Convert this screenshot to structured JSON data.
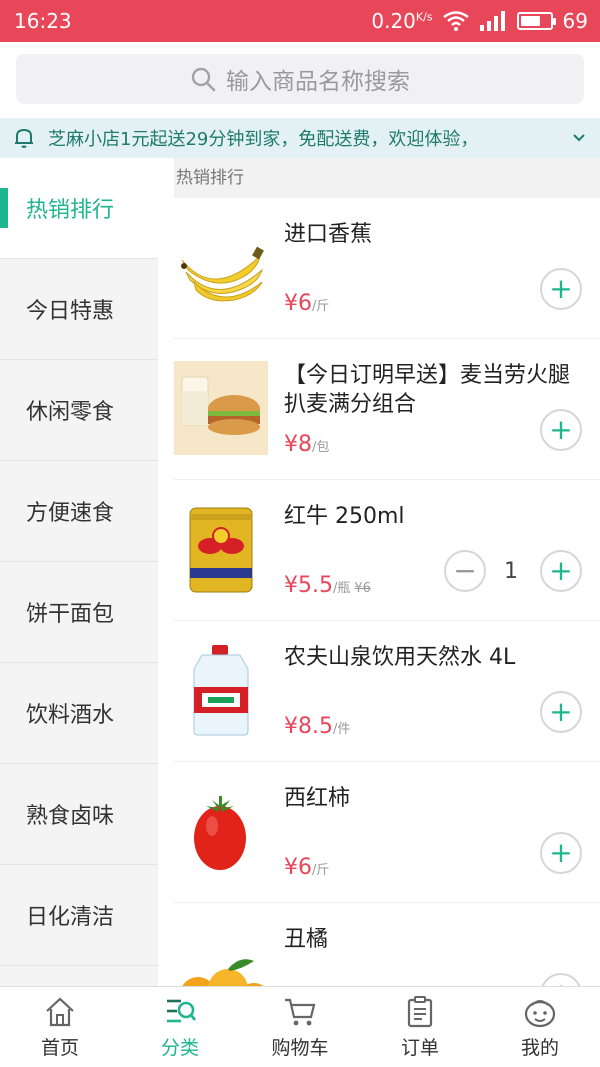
{
  "status": {
    "time": "16:23",
    "network": "0.20",
    "network_unit": "K/s",
    "battery": "69",
    "battery_level": 0.69
  },
  "search": {
    "placeholder": "输入商品名称搜索"
  },
  "notice": {
    "text": "芝麻小店1元起送29分钟到家，免配送费，欢迎体验，"
  },
  "sidebar": {
    "items": [
      {
        "label": "热销排行",
        "active": true
      },
      {
        "label": "今日特惠"
      },
      {
        "label": "休闲零食"
      },
      {
        "label": "方便速食"
      },
      {
        "label": "饼干面包"
      },
      {
        "label": "饮料酒水"
      },
      {
        "label": "熟食卤味"
      },
      {
        "label": "日化清洁"
      }
    ]
  },
  "section": {
    "title": "热销排行"
  },
  "products": [
    {
      "name": "进口香蕉",
      "price": "¥6",
      "unit": "/斤",
      "image": "banana"
    },
    {
      "name": "【今日订明早送】麦当劳火腿扒麦满分组合",
      "price": "¥8",
      "unit": "/包",
      "image": "burger-milk"
    },
    {
      "name": "红牛 250ml",
      "price": "¥5.5",
      "unit": "/瓶",
      "old_price": "¥6",
      "quantity": "1",
      "image": "redbull-can"
    },
    {
      "name": "农夫山泉饮用天然水 4L",
      "price": "¥8.5",
      "unit": "/件",
      "image": "water-bottle"
    },
    {
      "name": "西红柿",
      "price": "¥6",
      "unit": "/斤",
      "image": "tomato"
    },
    {
      "name": "丑橘",
      "image": "tangerine"
    }
  ],
  "tabbar": {
    "items": [
      {
        "label": "首页",
        "icon": "home-icon"
      },
      {
        "label": "分类",
        "icon": "category-icon",
        "active": true
      },
      {
        "label": "购物车",
        "icon": "cart-icon"
      },
      {
        "label": "订单",
        "icon": "order-icon"
      },
      {
        "label": "我的",
        "icon": "profile-icon"
      }
    ]
  },
  "colors": {
    "accent": "#1fb58f",
    "price": "#e8475a",
    "status_bar": "#e8475a"
  }
}
